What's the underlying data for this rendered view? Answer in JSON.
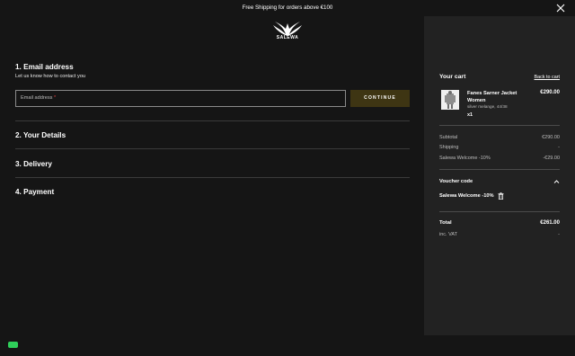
{
  "banner": {
    "text": "Free Shipping for orders above €100"
  },
  "brand": {
    "name": "SALEWA"
  },
  "checkout": {
    "step1": {
      "title": "1. Email address",
      "subtitle": "Let us know how to contact you",
      "email_placeholder": "Email address",
      "required_mark": "*",
      "continue_label": "CONTINUE"
    },
    "step2": {
      "title": "2. Your Details"
    },
    "step3": {
      "title": "3. Delivery"
    },
    "step4": {
      "title": "4. Payment"
    }
  },
  "cart": {
    "title": "Your cart",
    "back_label": "Back to cart",
    "item": {
      "name": "Fanes Sarner Jacket Women",
      "price": "€290.00",
      "variant": "silver melange, 44/38",
      "qty": "x1"
    },
    "subtotal_label": "Subtotal",
    "subtotal_value": "€290.00",
    "shipping_label": "Shipping",
    "shipping_value": "-",
    "discount_label": "Salewa Welcome -10%",
    "discount_value": "-€29.00",
    "voucher_title": "Voucher code",
    "voucher_code": "Salewa Welcome -10%",
    "total_label": "Total",
    "total_value": "€261.00",
    "vat_label": "inc. VAT",
    "vat_value": "-"
  },
  "colors": {
    "background": "#151515",
    "sidebar": "#222222",
    "continue_button": "#3e3513",
    "chat_button": "#2fcf5a"
  },
  "icons": {
    "close": "close-icon",
    "logo": "salewa-eagle-logo",
    "chevron": "chevron-up-icon",
    "trash": "trash-icon",
    "chat": "chat-icon"
  }
}
